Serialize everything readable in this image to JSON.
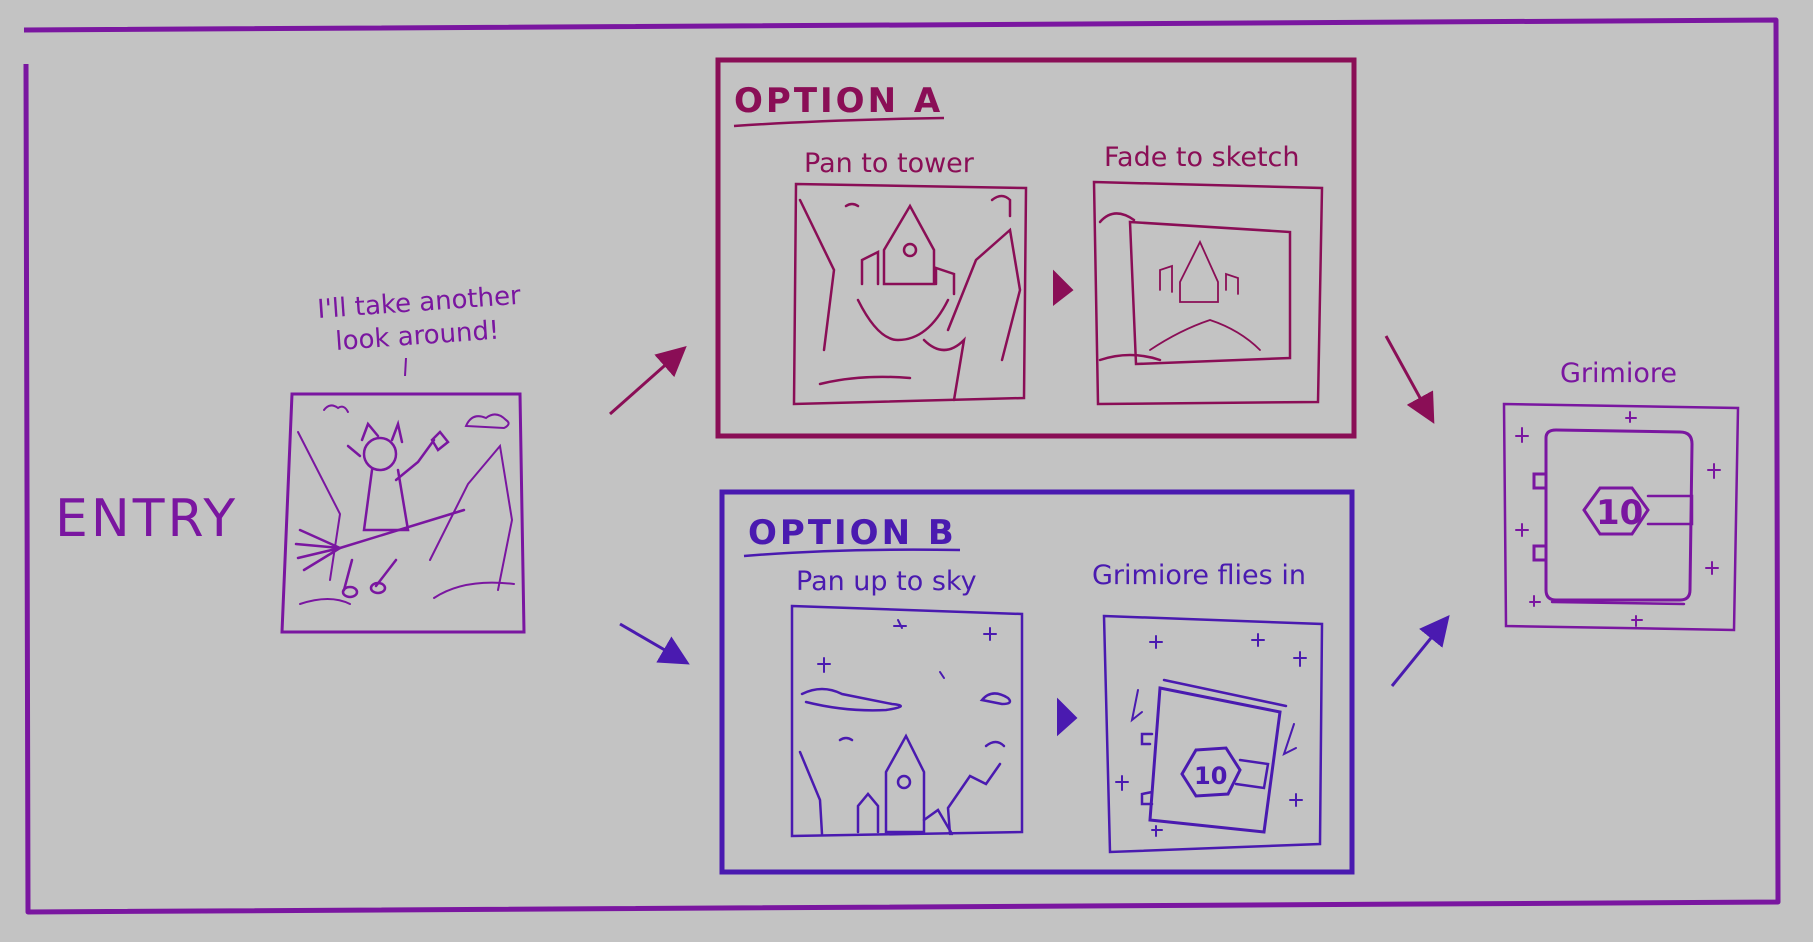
{
  "colors": {
    "background": "#c3c3c3",
    "entry": "#7a16a0",
    "option_a": "#8a0e56",
    "option_b": "#4a1ab0",
    "grimiore": "#7a16a0"
  },
  "entry": {
    "label": "ENTRY",
    "speech_line1": "I'll take another",
    "speech_line2": "look around!"
  },
  "option_a": {
    "title": "OPTION A",
    "panel1_caption": "Pan to tower",
    "panel2_caption": "Fade to sketch"
  },
  "option_b": {
    "title": "OPTION B",
    "panel1_caption": "Pan up to sky",
    "panel2_caption": "Grimiore flies in",
    "badge": "10"
  },
  "end": {
    "caption": "Grimiore",
    "badge": "10"
  }
}
